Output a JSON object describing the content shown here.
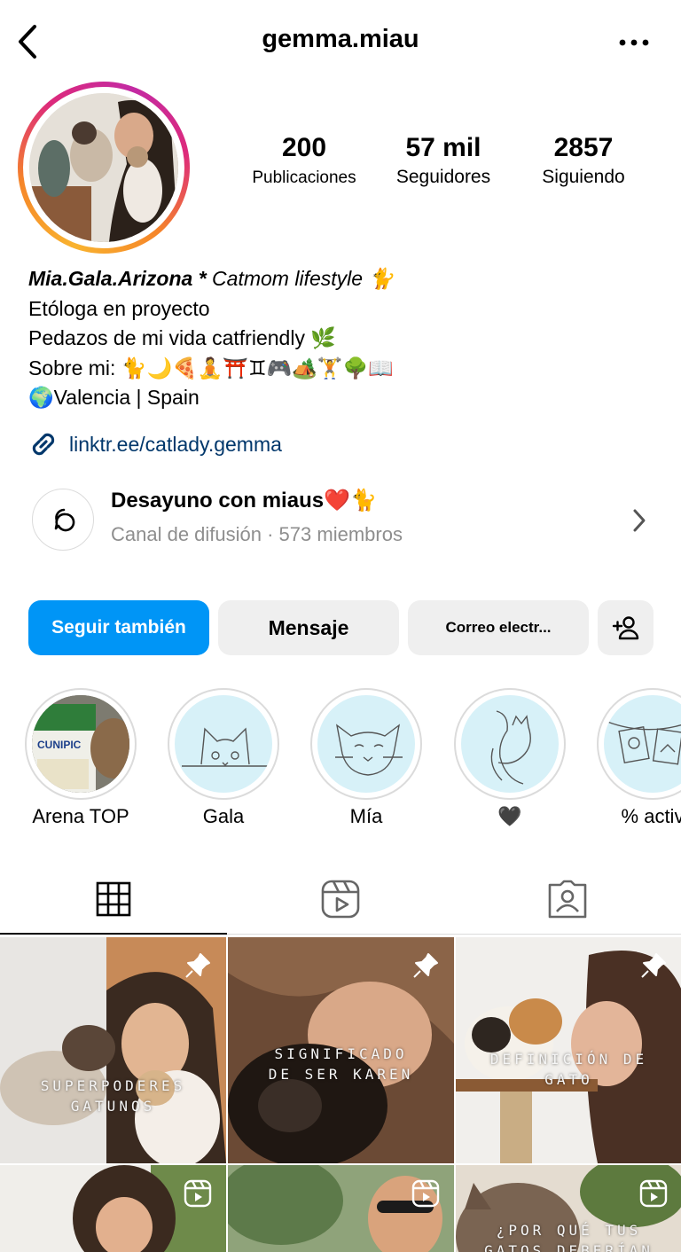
{
  "header": {
    "username": "gemma.miau"
  },
  "stats": {
    "posts": {
      "value": "200",
      "label": "Publicaciones"
    },
    "followers": {
      "value": "57 mil",
      "label": "Seguidores"
    },
    "following": {
      "value": "2857",
      "label": "Siguiendo"
    }
  },
  "bio": {
    "name_bold": "Mia.Gala.Arizona *",
    "name_rest": " Catmom lifestyle 🐈",
    "line1": "Etóloga en proyecto",
    "line2": "Pedazos de mi vida catfriendly 🌿",
    "line3": "Sobre mi: 🐈🌙🍕🧘⛩️♊🎮🏕️🏋️🌳📖",
    "line4": "🌍Valencia | Spain"
  },
  "link": {
    "text": "linktr.ee/catlady.gemma"
  },
  "channel": {
    "title": "Desayuno con miaus❤️🐈",
    "subtitle": "Canal de difusión · 573 miembros"
  },
  "buttons": {
    "follow_back": "Seguir también",
    "message": "Mensaje",
    "email": "Correo electr..."
  },
  "highlights": [
    {
      "label": "Arena TOP",
      "image_text": "CUNIPIC"
    },
    {
      "label": "Gala"
    },
    {
      "label": "Mía"
    },
    {
      "label": "🖤"
    },
    {
      "label": "% activ"
    }
  ],
  "grid": [
    {
      "caption": "SUPERPODERES GATUNOS",
      "pinned": true
    },
    {
      "caption": "SIGNIFICADO DE SER KAREN",
      "pinned": true
    },
    {
      "caption": "DEFINICIÓN DE GATO",
      "pinned": true
    },
    {
      "caption": "",
      "reel": true
    },
    {
      "caption": "",
      "reel": true
    },
    {
      "caption": "¿POR QUÉ TUS GATOS DEBERÍAN TENER",
      "reel": true
    }
  ],
  "colors": {
    "primary": "#0095f6",
    "link": "#00376b",
    "muted": "#8e8e8e",
    "button_bg": "#efefef",
    "highlight_bg": "#d7f1f8"
  },
  "icons": [
    "chevron-left-icon",
    "more-icon",
    "link-icon",
    "broadcast-icon",
    "chevron-right-icon",
    "add-person-icon",
    "grid-icon",
    "reels-icon",
    "tagged-icon",
    "pin-icon",
    "reel-icon"
  ]
}
